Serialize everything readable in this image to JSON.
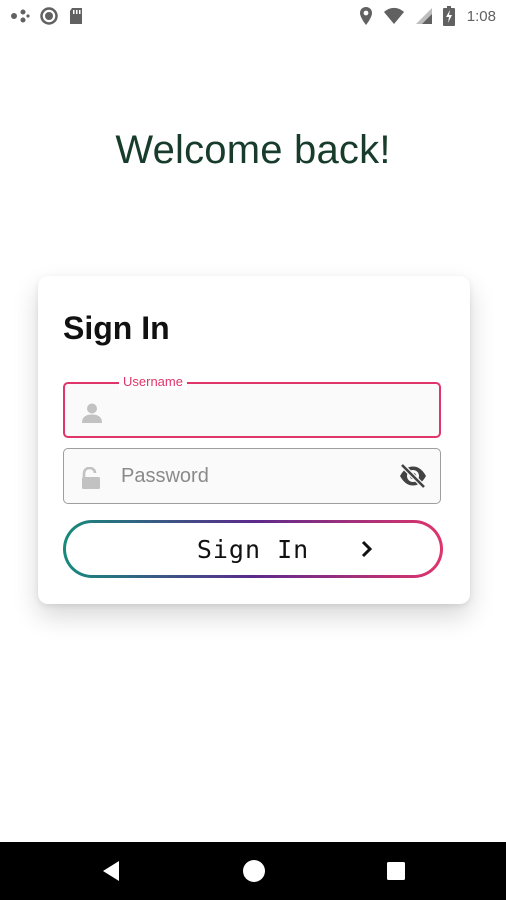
{
  "status_bar": {
    "time": "1:08",
    "icons": [
      "dots-notification-icon",
      "circle-notification-icon",
      "sd-card-icon",
      "location-icon",
      "wifi-icon",
      "signal-icon",
      "battery-charging-icon"
    ]
  },
  "welcome": {
    "text": "Welcome back!"
  },
  "login_card": {
    "title": "Sign In",
    "username": {
      "label": "Username",
      "value": "",
      "icon": "person-icon"
    },
    "password": {
      "placeholder": "Password",
      "value": "",
      "icon": "unlock-icon",
      "toggle_icon": "visibility-off-icon"
    },
    "submit": {
      "label": "Sign In",
      "icon": "chevron-right-icon"
    }
  },
  "nav_bar": {
    "items": [
      "back-icon",
      "home-icon",
      "recents-icon"
    ]
  },
  "colors": {
    "accent": "#e0356b",
    "title": "#173c2b",
    "gradient_start": "#178a7c",
    "gradient_mid": "#5b2a8c",
    "gradient_end": "#e0356b"
  }
}
